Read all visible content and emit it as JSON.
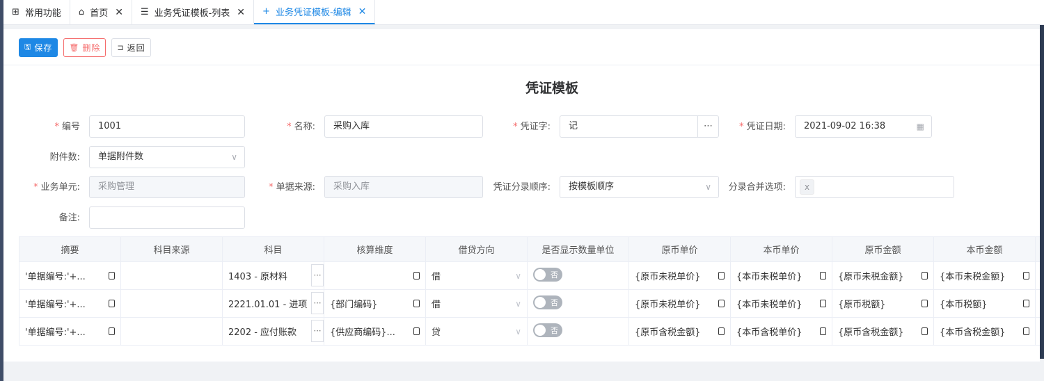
{
  "tabs": [
    {
      "label": "常用功能",
      "icon": "grid-icon",
      "glyph": "⊞",
      "closable": false
    },
    {
      "label": "首页",
      "icon": "home-icon",
      "glyph": "⌂",
      "closable": true
    },
    {
      "label": "业务凭证模板-列表",
      "icon": "list-icon",
      "glyph": "☰",
      "closable": true
    },
    {
      "label": "业务凭证模板-编辑",
      "icon": "plus-icon",
      "glyph": "+",
      "closable": true,
      "active": true
    }
  ],
  "toolbar": {
    "save": "保存",
    "delete": "删除",
    "back": "返回"
  },
  "form": {
    "title": "凭证模板",
    "code_label": "编号",
    "code_value": "1001",
    "name_label": "名称:",
    "name_value": "采购入库",
    "voucher_word_label": "凭证字:",
    "voucher_word_value": "记",
    "voucher_date_label": "凭证日期:",
    "voucher_date_value": "2021-09-02 16:38",
    "attachments_label": "附件数:",
    "attachments_value": "单据附件数",
    "business_unit_label": "业务单元:",
    "business_unit_value": "采购管理",
    "doc_source_label": "单据来源:",
    "doc_source_value": "采购入库",
    "entry_order_label": "凭证分录顺序:",
    "entry_order_value": "按模板顺序",
    "merge_label": "分录合并选项:",
    "merge_tag": "x",
    "remark_label": "备注:",
    "remark_value": ""
  },
  "table": {
    "headers": [
      "摘要",
      "科目来源",
      "科目",
      "核算维度",
      "借贷方向",
      "是否显示数量单位",
      "原币单价",
      "本币单价",
      "原币金额",
      "本币金额"
    ],
    "rows": [
      {
        "summary": "'单据编号:'+...",
        "source": "",
        "subject": "1403 - 原材料",
        "dimension": "",
        "direction": "借",
        "show_qty": "否",
        "orig_price": "{原币未税单价}",
        "local_price": "{本币未税单价}",
        "orig_amount": "{原币未税金额}",
        "local_amount": "{本币未税金额}"
      },
      {
        "summary": "'单据编号:'+...",
        "source": "",
        "subject": "2221.01.01 - 进项",
        "dimension": "{部门编码}",
        "direction": "借",
        "show_qty": "否",
        "orig_price": "{原币未税单价}",
        "local_price": "{本币未税单价}",
        "orig_amount": "{原币税额}",
        "local_amount": "{本币税额}"
      },
      {
        "summary": "'单据编号:'+...",
        "source": "",
        "subject": "2202 - 应付账款",
        "dimension": "{供应商编码}...",
        "direction": "贷",
        "show_qty": "否",
        "orig_price": "{原币含税金额}",
        "local_price": "{本币含税单价}",
        "orig_amount": "{原币含税金额}",
        "local_amount": "{本币含税金额}"
      }
    ]
  },
  "colors": {
    "primary": "#1e88e5",
    "danger": "#f56c6c",
    "required": "#f56c6c"
  }
}
